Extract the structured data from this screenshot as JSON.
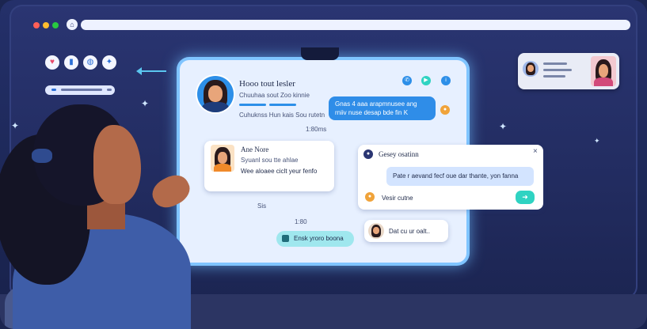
{
  "chat": {
    "header": {
      "title": "Hooo tout lesler",
      "subtitle": "Chuuhaa sout Zoo kinnie",
      "status": "Cuhuknss Hun kais Sou rutetn"
    },
    "blue_message": "Gnas 4 aaa arapmnusee ang rniiv nuse desap bde fin K",
    "timestamp": "1:80ms",
    "contact_card": {
      "name": "Ane Nore",
      "meta": "Syuanl sou tte ahlae",
      "message": "Wee aloaee ciclt yeur fenfo"
    },
    "popup": {
      "title": "Gesey osatinn",
      "message": "Pate r aevand fecf oue dar thante, yon fanna",
      "reply_placeholder": "Vesir cutne",
      "send_icon": "send-arrow-icon"
    },
    "reply_bubble": "Dat cu ur oalt..",
    "action_pill": "Ensk yroro boona",
    "time_small": "1:80",
    "extra_text": "Sis"
  },
  "colors": {
    "panel": "#e7f0ff",
    "accent_blue": "#2f8de8",
    "accent_teal": "#2fd3c2",
    "glow": "#7fc4ff"
  }
}
